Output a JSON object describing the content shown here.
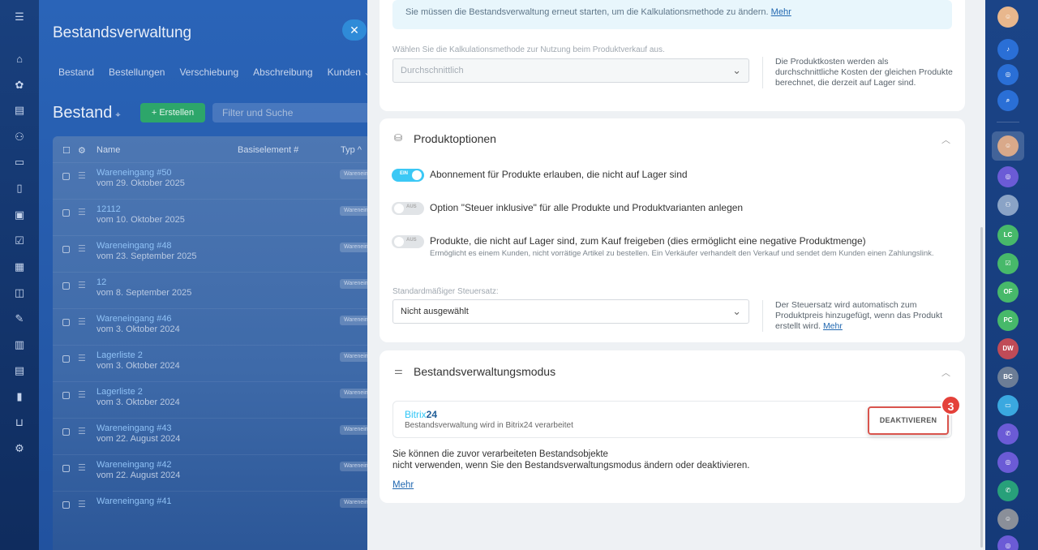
{
  "background": {
    "title": "Bestandsverwaltung",
    "tabs": [
      "Bestand",
      "Bestellungen",
      "Verschiebung",
      "Abschreibung",
      "Kunden ⌄"
    ],
    "page_title": "Bestand",
    "create_label": "+ Erstellen",
    "filter_placeholder": "Filter und Suche",
    "columns": [
      "Name",
      "Basiselement #",
      "Typ ^"
    ],
    "rows": [
      {
        "name": "Wareneingang #50",
        "date": "vom 29. Oktober 2025",
        "tag": "Wareneing"
      },
      {
        "name": "12112",
        "date": "vom 10. Oktober 2025",
        "tag": "Wareneing"
      },
      {
        "name": "Wareneingang #48",
        "date": "vom 23. September 2025",
        "tag": "Wareneing"
      },
      {
        "name": "12",
        "date": "vom 8. September 2025",
        "tag": "Wareneing"
      },
      {
        "name": "Wareneingang #46",
        "date": "vom 3. Oktober 2024",
        "tag": "Wareneing"
      },
      {
        "name": "Lagerliste 2",
        "date": "vom 3. Oktober 2024",
        "tag": "Wareneing"
      },
      {
        "name": "Lagerliste 2",
        "date": "vom 3. Oktober 2024",
        "tag": "Wareneing"
      },
      {
        "name": "Wareneingang #43",
        "date": "vom 22. August 2024",
        "tag": "Wareneing"
      },
      {
        "name": "Wareneingang #42",
        "date": "vom 22. August 2024",
        "tag": "Wareneing"
      },
      {
        "name": "Wareneingang #41",
        "date": "",
        "tag": "Wareneing"
      }
    ]
  },
  "panel": {
    "info_text": "Sie müssen die Bestandsverwaltung erneut starten, um die Kalkulationsmethode zu ändern.",
    "info_link": "Mehr",
    "calc_label": "Wählen Sie die Kalkulationsmethode zur Nutzung beim Produktverkauf aus.",
    "calc_value": "Durchschnittlich",
    "calc_hint": "Die Produktkosten werden als durchschnittliche Kosten der gleichen Produkte berechnet, die derzeit auf Lager sind.",
    "options_title": "Produktoptionen",
    "toggle_on_label": "EIN",
    "toggle_off_label": "AUS",
    "opt1": "Abonnement für Produkte erlauben, die nicht auf Lager sind",
    "opt2": "Option \"Steuer inklusive\" für alle Produkte und Produktvarianten anlegen",
    "opt3": "Produkte, die nicht auf Lager sind, zum Kauf freigeben (dies ermöglicht eine negative Produktmenge)",
    "opt3_sub": "Ermöglicht es einem Kunden, nicht vorrätige Artikel zu bestellen. Ein Verkäufer verhandelt den Verkauf und sendet dem Kunden einen Zahlungslink.",
    "tax_label": "Standardmäßiger Steuersatz:",
    "tax_value": "Nicht ausgewählt",
    "tax_hint": "Der Steuersatz wird automatisch zum Produktpreis hinzugefügt, wenn das Produkt erstellt wird.",
    "tax_link": "Mehr",
    "mode_title": "Bestandsverwaltungsmodus",
    "mode_brand_a": "Bitrix",
    "mode_brand_b": "24",
    "mode_desc": "Bestandsverwaltung wird in Bitrix24 verarbeitet",
    "deactivate_label": "DEAKTIVIEREN",
    "step_number": "3",
    "mode_text_1": "Sie können die zuvor verarbeiteten Bestandsobjekte",
    "mode_text_2": "nicht verwenden, wenn Sie den Bestandsverwaltungsmodus ändern oder deaktivieren.",
    "mode_link": "Mehr"
  },
  "right_nav": [
    {
      "label": "",
      "color": "#f3b33d"
    },
    {
      "label": "LC",
      "color": "#47b96a"
    },
    {
      "label": "OF",
      "color": "#47b96a"
    },
    {
      "label": "PC",
      "color": "#47b96a"
    },
    {
      "label": "DW",
      "color": "#c04b57"
    },
    {
      "label": "BC",
      "color": "#6c7d96"
    }
  ]
}
